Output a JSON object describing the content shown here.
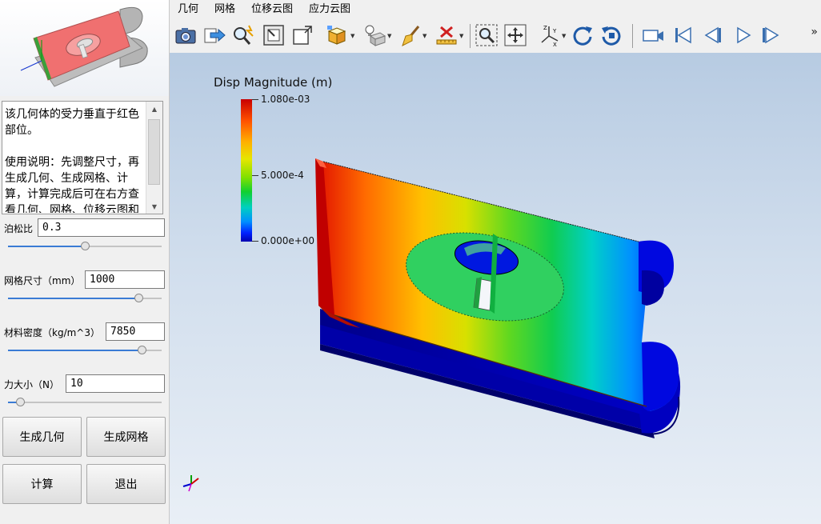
{
  "left_panel": {
    "description": "该几何体的受力垂直于红色部位。\n\n使用说明：先调整尺寸，再生成几何、生成网格、计算，计算完成后可在右方查看几何、网格、位移云图和应力云图。",
    "params": [
      {
        "label": "泊松比",
        "value": "0.3",
        "slider_fraction": 0.5
      },
      {
        "label": "网格尺寸（mm）",
        "value": "1000",
        "slider_fraction": 0.85
      },
      {
        "label": "材料密度（kg/m^3）",
        "value": "7850",
        "slider_fraction": 0.87
      },
      {
        "label": "力大小（N）",
        "value": "10",
        "slider_fraction": 0.08
      }
    ],
    "buttons": {
      "gen_geometry": "生成几何",
      "gen_mesh": "生成网格",
      "compute": "计算",
      "exit": "退出"
    }
  },
  "menu": [
    "几何",
    "网格",
    "位移云图",
    "应力云图"
  ],
  "toolbar": {
    "icons": [
      "camera-icon",
      "export-icon",
      "zoom-magic-icon",
      "fit-frame-icon",
      "reset-view-icon",
      "view-cube-icon",
      "light-icon",
      "brush-icon",
      "clear-icon",
      "zoom-box-icon",
      "pan-icon",
      "axes-orient-icon",
      "rotate-cw-icon",
      "rotate-ccw-icon",
      "record-icon",
      "first-frame-icon",
      "prev-frame-icon",
      "play-icon",
      "last-frame-icon"
    ],
    "more": "»"
  },
  "legend": {
    "title": "Disp Magnitude (m)",
    "max": "1.080e-03",
    "mid": "5.000e-4",
    "min": "0.000e+00"
  },
  "colors": {
    "accent": "#3a7bd5",
    "red_face": "#f07070",
    "high": "#c80000",
    "low": "#0000d0"
  }
}
